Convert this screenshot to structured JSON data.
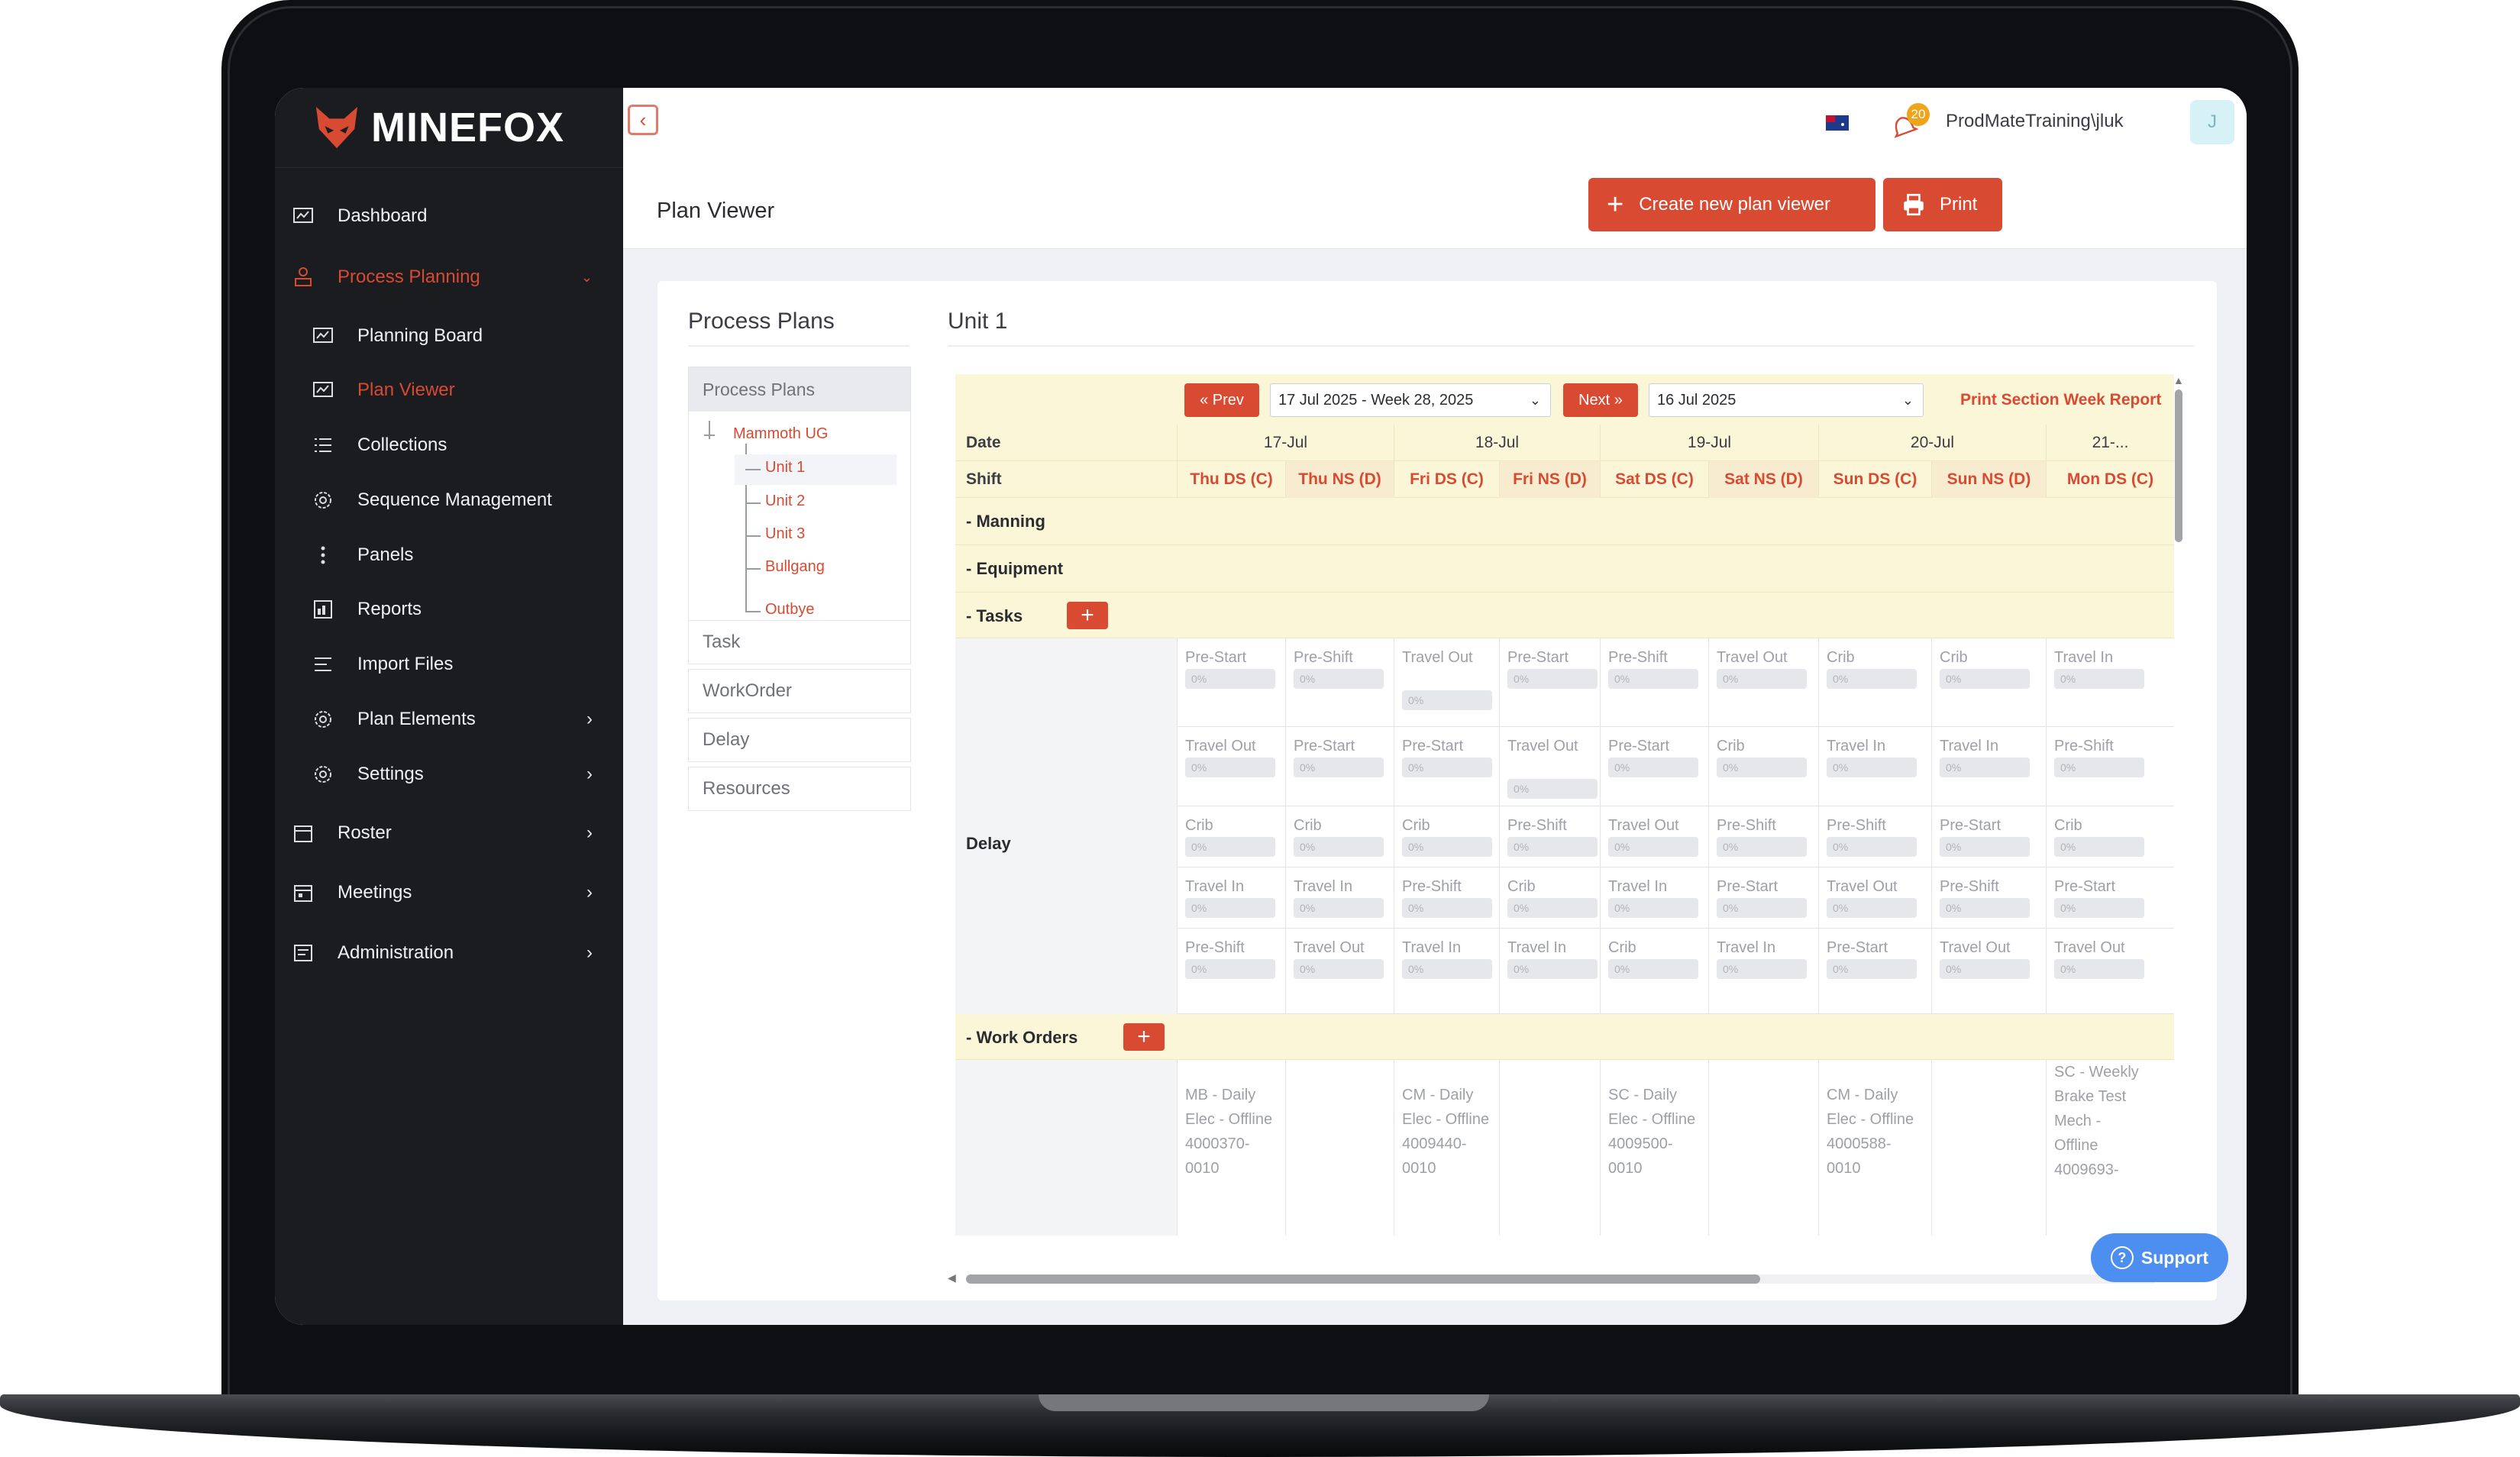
{
  "brand": {
    "name": "MINEFOX"
  },
  "sidebar": {
    "items": [
      {
        "label": "Dashboard"
      },
      {
        "label": "Process Planning"
      },
      {
        "label": "Planning Board"
      },
      {
        "label": "Plan Viewer"
      },
      {
        "label": "Collections"
      },
      {
        "label": "Sequence Management"
      },
      {
        "label": "Panels"
      },
      {
        "label": "Reports"
      },
      {
        "label": "Import Files"
      },
      {
        "label": "Plan Elements"
      },
      {
        "label": "Settings"
      },
      {
        "label": "Roster"
      },
      {
        "label": "Meetings"
      },
      {
        "label": "Administration"
      }
    ]
  },
  "topbar": {
    "collapse_icon": "‹",
    "notification_count": "20",
    "user_name": "ProdMateTraining\\jluk",
    "avatar_initial": "J"
  },
  "page": {
    "title": "Plan Viewer",
    "create_button": "Create new plan viewer",
    "print_button": "Print"
  },
  "process_plans": {
    "title": "Process Plans",
    "header": "Process Plans",
    "tree": {
      "root": "Mammoth UG",
      "children": [
        "Unit 1",
        "Unit 2",
        "Unit 3",
        "Bullgang",
        "Outbye"
      ]
    },
    "tabs": [
      "Task",
      "WorkOrder",
      "Delay",
      "Resources"
    ]
  },
  "unit": {
    "title": "Unit 1",
    "prev": "« Prev",
    "next": "Next »",
    "week_select": "17 Jul 2025 - Week 28, 2025",
    "date_select": "16 Jul 2025",
    "print_link": "Print Section Week Report",
    "date_label": "Date",
    "shift_label": "Shift",
    "dates": [
      "17-Jul",
      "18-Jul",
      "19-Jul",
      "20-Jul",
      "21-..."
    ],
    "shifts": [
      "Thu DS (C)",
      "Thu NS (D)",
      "Fri DS (C)",
      "Fri NS (D)",
      "Sat DS (C)",
      "Sat NS (D)",
      "Sun DS (C)",
      "Sun NS (D)",
      "Mon DS (C)"
    ],
    "sections": {
      "manning": "Manning",
      "equipment": "Equipment",
      "tasks": "Tasks",
      "work_orders": "Work Orders",
      "delay": "Delay"
    },
    "progress_label": "0%",
    "task_rows": [
      [
        "Pre-Start",
        "Pre-Shift",
        "Travel Out",
        "Pre-Start",
        "Pre-Shift",
        "Travel Out",
        "Crib",
        "Crib",
        "Travel In"
      ],
      [
        "Travel Out",
        "Pre-Start",
        "Pre-Start",
        "Travel Out",
        "Pre-Start",
        "Crib",
        "Travel In",
        "Travel In",
        "Pre-Shift"
      ],
      [
        "Crib",
        "Crib",
        "Crib",
        "Pre-Shift",
        "Travel Out",
        "Pre-Shift",
        "Pre-Shift",
        "Pre-Start",
        "Crib"
      ],
      [
        "Travel In",
        "Travel In",
        "Pre-Shift",
        "Crib",
        "Travel In",
        "Pre-Start",
        "Travel Out",
        "Pre-Shift",
        "Pre-Start"
      ],
      [
        "Pre-Shift",
        "Travel Out",
        "Travel In",
        "Travel In",
        "Crib",
        "Travel In",
        "Pre-Start",
        "Travel Out",
        "Travel Out"
      ]
    ],
    "work_orders": [
      "MB - Daily Elec - Offline 4000370-0010",
      "",
      "CM - Daily Elec - Offline 4009440-0010",
      "",
      "SC - Daily Elec - Offline 4009500-0010",
      "",
      "CM - Daily Elec - Offline 4000588-0010",
      "",
      "SC - Weekly Brake Test Mech - Offline 4009693-"
    ]
  },
  "support": {
    "label": "Support"
  },
  "colors": {
    "accent": "#d84a32",
    "sidebar": "#1b1c20",
    "highlight": "#fbf6d8",
    "support": "#4d8ff0"
  }
}
